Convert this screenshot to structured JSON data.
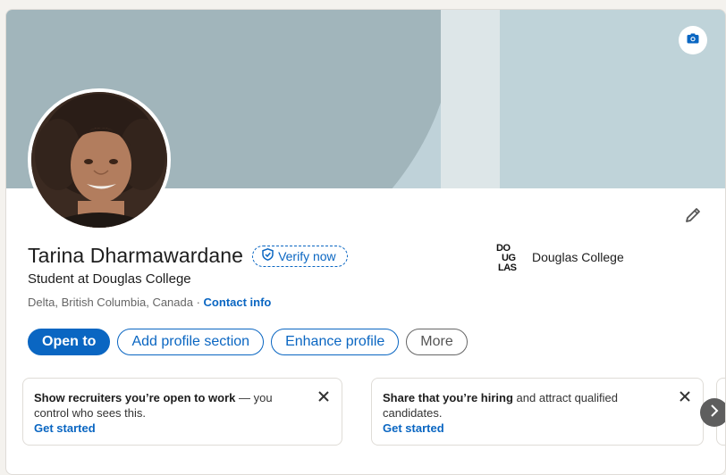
{
  "profile": {
    "name": "Tarina Dharmawardane",
    "verify_label": "Verify now",
    "headline": "Student at Douglas College",
    "location": "Delta, British Columbia, Canada",
    "separator": " · ",
    "contact_label": "Contact info"
  },
  "organization": {
    "logo_text": "DOUGLAS",
    "name": "Douglas College"
  },
  "actions": {
    "open_to": "Open to",
    "add_section": "Add profile section",
    "enhance": "Enhance profile",
    "more": "More"
  },
  "promos": [
    {
      "strong": "Show recruiters you’re open to work",
      "rest": " — you control who sees this.",
      "link": "Get started"
    },
    {
      "strong": "Share that you’re hiring",
      "rest": " and attract qualified candidates.",
      "link": "Get started"
    }
  ],
  "icons": {
    "camera": "camera-icon",
    "edit": "pencil-icon",
    "verify": "shield-check-icon",
    "close": "close-icon",
    "next": "chevron-right-icon"
  },
  "colors": {
    "accent": "#0a66c2",
    "banner_dark": "#a1b5bb",
    "banner_light": "#bfd2d9"
  }
}
